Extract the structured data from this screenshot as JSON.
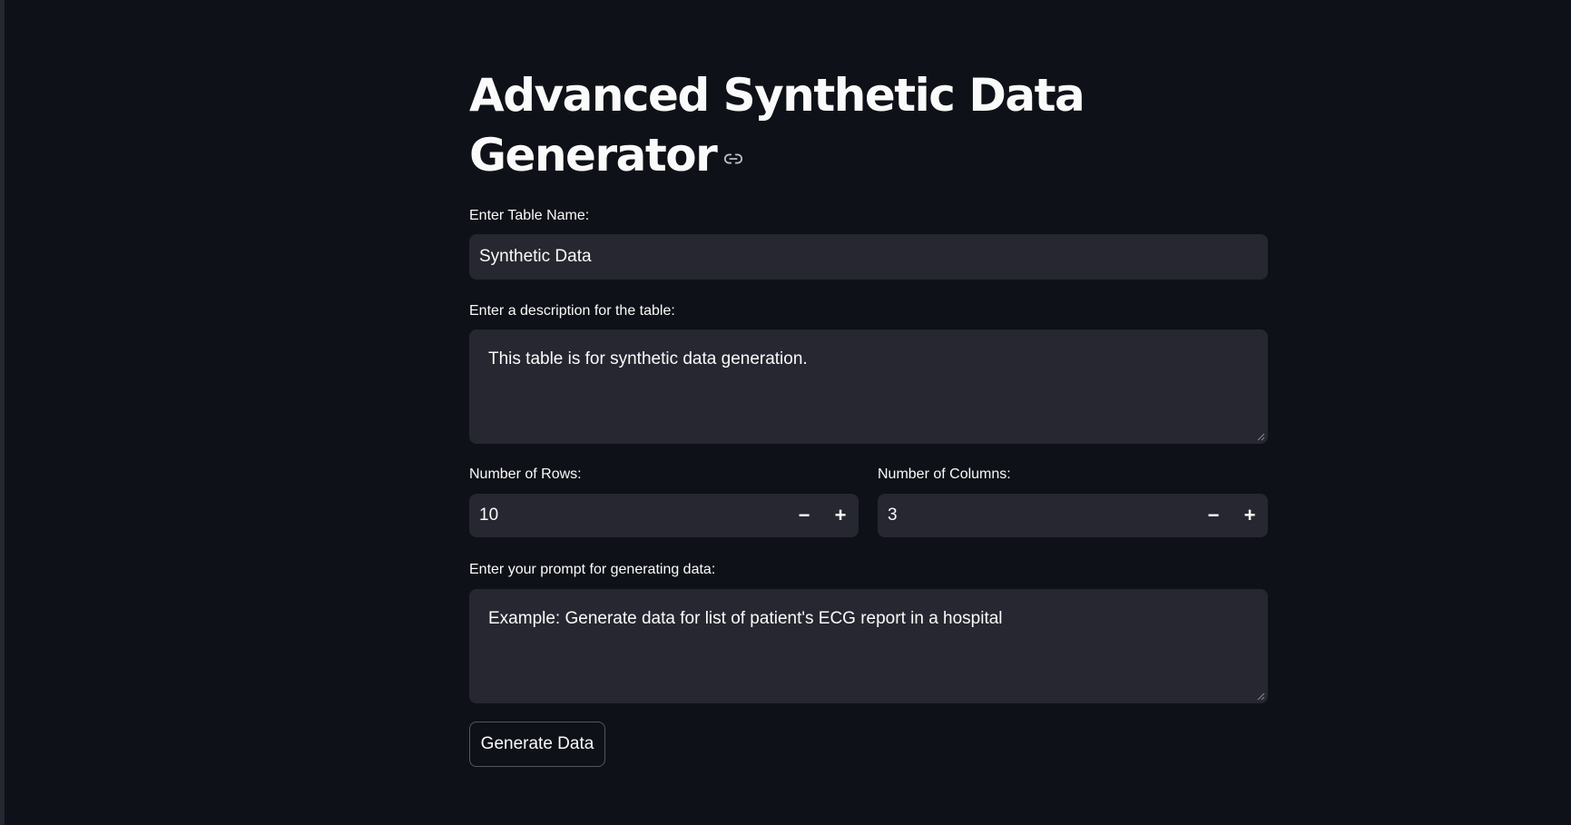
{
  "page": {
    "title": "Advanced Synthetic Data Generator"
  },
  "icons": {
    "title_anchor": "link-icon"
  },
  "colors": {
    "background": "#0e1117",
    "input_background": "#262730",
    "text": "#fafafa"
  },
  "form": {
    "table_name": {
      "label": "Enter Table Name:",
      "value": "Synthetic Data"
    },
    "description": {
      "label": "Enter a description for the table:",
      "value": "This table is for synthetic data generation."
    },
    "rows": {
      "label": "Number of Rows:",
      "value": "10",
      "decrement": "−",
      "increment": "+"
    },
    "columns": {
      "label": "Number of Columns:",
      "value": "3",
      "decrement": "−",
      "increment": "+"
    },
    "prompt": {
      "label": "Enter your prompt for generating data:",
      "placeholder": "Example: Generate data for list of patient's ECG report in a hospital"
    },
    "generate_button": {
      "label": "Generate Data"
    }
  }
}
